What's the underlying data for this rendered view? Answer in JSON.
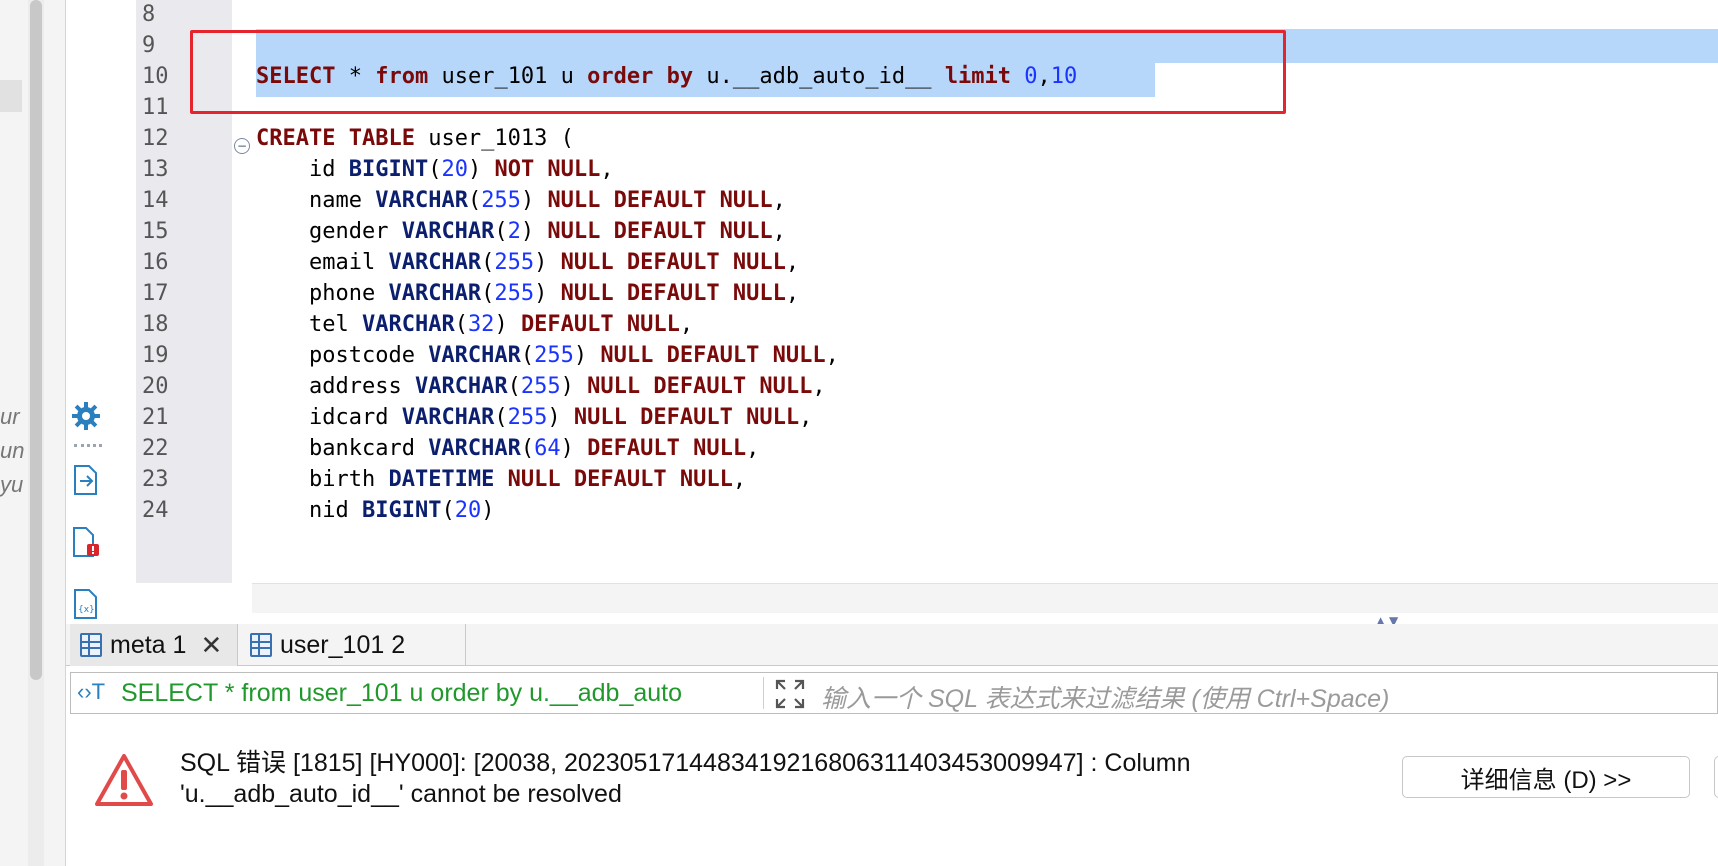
{
  "editor": {
    "lines": [
      {
        "n": "8",
        "tokens": []
      },
      {
        "n": "9",
        "tokens": []
      },
      {
        "n": "10",
        "tokens": [
          {
            "t": "SELECT",
            "c": "kw"
          },
          {
            "t": " * ",
            "c": ""
          },
          {
            "t": "from",
            "c": "kw"
          },
          {
            "t": " user_101 u ",
            "c": ""
          },
          {
            "t": "order by",
            "c": "kw"
          },
          {
            "t": " u.__adb_auto_id__ ",
            "c": ""
          },
          {
            "t": "limit",
            "c": "kw"
          },
          {
            "t": " ",
            "c": ""
          },
          {
            "t": "0",
            "c": "num"
          },
          {
            "t": ",",
            "c": ""
          },
          {
            "t": "10",
            "c": "num"
          }
        ]
      },
      {
        "n": "11",
        "tokens": []
      },
      {
        "n": "12",
        "tokens": [
          {
            "t": "CREATE TABLE",
            "c": "kw"
          },
          {
            "t": " user_1013 (",
            "c": ""
          }
        ]
      },
      {
        "n": "13",
        "tokens": [
          {
            "t": "    id ",
            "c": ""
          },
          {
            "t": "BIGINT",
            "c": "ty"
          },
          {
            "t": "(",
            "c": ""
          },
          {
            "t": "20",
            "c": "num"
          },
          {
            "t": ") ",
            "c": ""
          },
          {
            "t": "NOT NULL",
            "c": "kw"
          },
          {
            "t": ",",
            "c": ""
          }
        ]
      },
      {
        "n": "14",
        "tokens": [
          {
            "t": "    name ",
            "c": ""
          },
          {
            "t": "VARCHAR",
            "c": "ty"
          },
          {
            "t": "(",
            "c": ""
          },
          {
            "t": "255",
            "c": "num"
          },
          {
            "t": ") ",
            "c": ""
          },
          {
            "t": "NULL DEFAULT NULL",
            "c": "kw"
          },
          {
            "t": ",",
            "c": ""
          }
        ]
      },
      {
        "n": "15",
        "tokens": [
          {
            "t": "    gender ",
            "c": ""
          },
          {
            "t": "VARCHAR",
            "c": "ty"
          },
          {
            "t": "(",
            "c": ""
          },
          {
            "t": "2",
            "c": "num"
          },
          {
            "t": ") ",
            "c": ""
          },
          {
            "t": "NULL DEFAULT NULL",
            "c": "kw"
          },
          {
            "t": ",",
            "c": ""
          }
        ]
      },
      {
        "n": "16",
        "tokens": [
          {
            "t": "    email ",
            "c": ""
          },
          {
            "t": "VARCHAR",
            "c": "ty"
          },
          {
            "t": "(",
            "c": ""
          },
          {
            "t": "255",
            "c": "num"
          },
          {
            "t": ") ",
            "c": ""
          },
          {
            "t": "NULL DEFAULT NULL",
            "c": "kw"
          },
          {
            "t": ",",
            "c": ""
          }
        ]
      },
      {
        "n": "17",
        "tokens": [
          {
            "t": "    phone ",
            "c": ""
          },
          {
            "t": "VARCHAR",
            "c": "ty"
          },
          {
            "t": "(",
            "c": ""
          },
          {
            "t": "255",
            "c": "num"
          },
          {
            "t": ") ",
            "c": ""
          },
          {
            "t": "NULL DEFAULT NULL",
            "c": "kw"
          },
          {
            "t": ",",
            "c": ""
          }
        ]
      },
      {
        "n": "18",
        "tokens": [
          {
            "t": "    tel ",
            "c": ""
          },
          {
            "t": "VARCHAR",
            "c": "ty"
          },
          {
            "t": "(",
            "c": ""
          },
          {
            "t": "32",
            "c": "num"
          },
          {
            "t": ") ",
            "c": ""
          },
          {
            "t": "DEFAULT NULL",
            "c": "kw"
          },
          {
            "t": ",",
            "c": ""
          }
        ]
      },
      {
        "n": "19",
        "tokens": [
          {
            "t": "    postcode ",
            "c": ""
          },
          {
            "t": "VARCHAR",
            "c": "ty"
          },
          {
            "t": "(",
            "c": ""
          },
          {
            "t": "255",
            "c": "num"
          },
          {
            "t": ") ",
            "c": ""
          },
          {
            "t": "NULL DEFAULT NULL",
            "c": "kw"
          },
          {
            "t": ",",
            "c": ""
          }
        ]
      },
      {
        "n": "20",
        "tokens": [
          {
            "t": "    address ",
            "c": ""
          },
          {
            "t": "VARCHAR",
            "c": "ty"
          },
          {
            "t": "(",
            "c": ""
          },
          {
            "t": "255",
            "c": "num"
          },
          {
            "t": ") ",
            "c": ""
          },
          {
            "t": "NULL DEFAULT NULL",
            "c": "kw"
          },
          {
            "t": ",",
            "c": ""
          }
        ]
      },
      {
        "n": "21",
        "tokens": [
          {
            "t": "    idcard ",
            "c": ""
          },
          {
            "t": "VARCHAR",
            "c": "ty"
          },
          {
            "t": "(",
            "c": ""
          },
          {
            "t": "255",
            "c": "num"
          },
          {
            "t": ") ",
            "c": ""
          },
          {
            "t": "NULL DEFAULT NULL",
            "c": "kw"
          },
          {
            "t": ",",
            "c": ""
          }
        ]
      },
      {
        "n": "22",
        "tokens": [
          {
            "t": "    bankcard ",
            "c": ""
          },
          {
            "t": "VARCHAR",
            "c": "ty"
          },
          {
            "t": "(",
            "c": ""
          },
          {
            "t": "64",
            "c": "num"
          },
          {
            "t": ") ",
            "c": ""
          },
          {
            "t": "DEFAULT NULL",
            "c": "kw"
          },
          {
            "t": ",",
            "c": ""
          }
        ]
      },
      {
        "n": "23",
        "tokens": [
          {
            "t": "    birth ",
            "c": ""
          },
          {
            "t": "DATETIME",
            "c": "ty"
          },
          {
            "t": " ",
            "c": ""
          },
          {
            "t": "NULL DEFAULT NULL",
            "c": "kw"
          },
          {
            "t": ",",
            "c": ""
          }
        ]
      },
      {
        "n": "24",
        "tokens": [
          {
            "t": "    nid ",
            "c": ""
          },
          {
            "t": "BIGINT",
            "c": "ty"
          },
          {
            "t": "(",
            "c": ""
          },
          {
            "t": "20",
            "c": "num"
          },
          {
            "t": ")",
            "c": ""
          }
        ]
      }
    ]
  },
  "left_fragments": [
    "ur",
    "un",
    "yu"
  ],
  "side_icons": [
    "gear-icon",
    "export-icon",
    "error-file-icon",
    "variables-icon"
  ],
  "tabs": [
    {
      "label": "meta 1",
      "active": true,
      "closable": true
    },
    {
      "label": "user_101 2",
      "active": false,
      "closable": false
    }
  ],
  "filter": {
    "icon_text": "‹›T",
    "query": "SELECT * from user_101 u order by u.__adb_auto",
    "placeholder": "输入一个 SQL 表达式来过滤结果 (使用 Ctrl+Space)"
  },
  "error": {
    "line1": "SQL 错误 [1815] [HY000]: [20038, 2023051714483419216806311403453009947] : Column",
    "line2": "'u.__adb_auto_id__' cannot be resolved",
    "detail_button": "详细信息 (D) >>"
  },
  "colors": {
    "keyword": "#7a0a0a",
    "type": "#0b1f6e",
    "number": "#1a33ff",
    "selection": "#b6d6fa",
    "highlight_box": "#e3262e",
    "filter_query": "#21982c"
  }
}
